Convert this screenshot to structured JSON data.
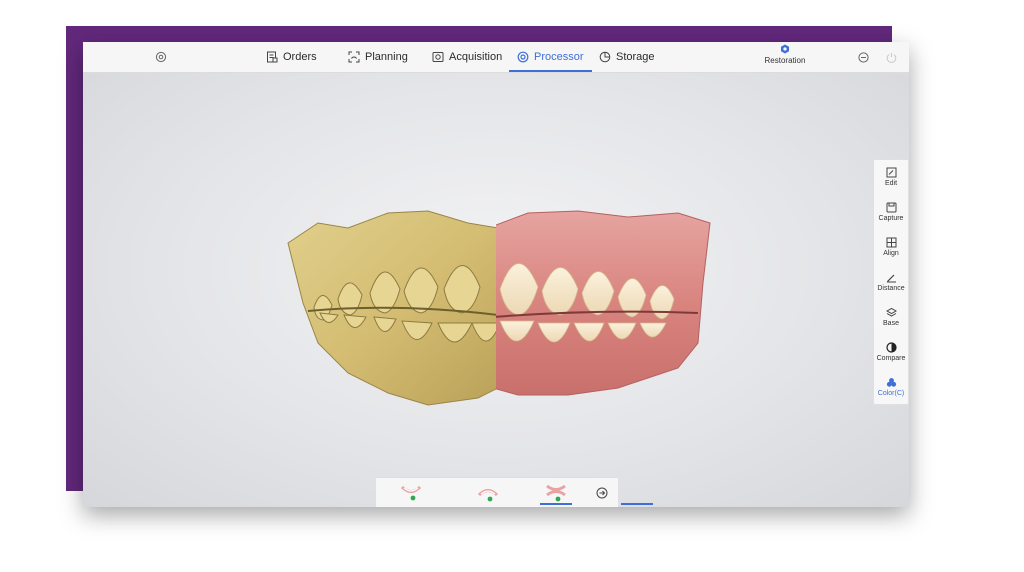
{
  "header": {
    "tabs": [
      {
        "label": "Orders",
        "icon": "orders-icon"
      },
      {
        "label": "Planning",
        "icon": "planning-icon"
      },
      {
        "label": "Acquisition",
        "icon": "acquisition-icon"
      },
      {
        "label": "Processor",
        "icon": "processor-icon",
        "active": true
      },
      {
        "label": "Storage",
        "icon": "storage-icon"
      }
    ],
    "restoration_label": "Restoration",
    "left_icon": "settings-icon",
    "right_icons": [
      "minimize-icon",
      "power-icon"
    ]
  },
  "tools": [
    {
      "label": "Edit",
      "icon": "edit-icon"
    },
    {
      "label": "Capture",
      "icon": "capture-icon"
    },
    {
      "label": "Align",
      "icon": "align-icon"
    },
    {
      "label": "Distance",
      "icon": "distance-icon"
    },
    {
      "label": "Base",
      "icon": "base-icon"
    },
    {
      "label": "Compare",
      "icon": "compare-icon"
    },
    {
      "label": "Color(C)",
      "icon": "color-icon",
      "active": true
    }
  ],
  "bottom_bar": {
    "buttons": [
      "upper-jaw-icon",
      "lower-jaw-icon",
      "bite-icon",
      "next-arrow-icon"
    ],
    "active_index": 2
  },
  "colors": {
    "accent": "#3e6fd8",
    "status_ok": "#2fa84f",
    "background_purple": "#62287c",
    "model_stone": "#d9c37a",
    "gum": "#d98a8a"
  }
}
